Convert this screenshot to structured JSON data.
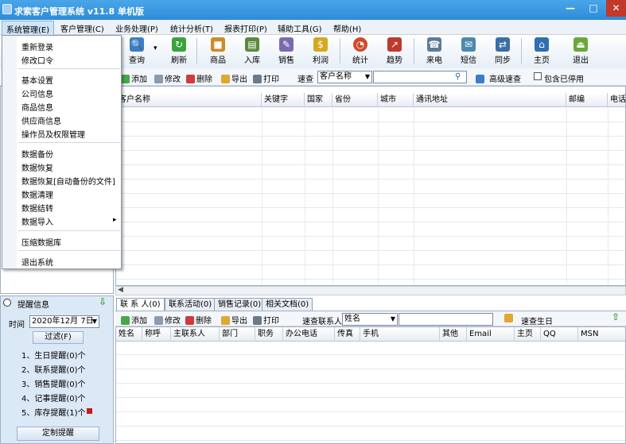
{
  "window": {
    "title": "求索客户管理系统 v11.8 单机版",
    "min": "—",
    "max": "□",
    "close": "✕"
  },
  "menu": [
    "系统管理(E)",
    "客户管理(C)",
    "业务处理(P)",
    "统计分析(T)",
    "报表打印(P)",
    "辅助工具(G)",
    "帮助(H)"
  ],
  "toolbar": [
    {
      "label": "查询",
      "icon": "search-icon",
      "color": "#3a7dc8",
      "glyph": "🔍"
    },
    {
      "label": "刷新",
      "icon": "refresh-icon",
      "color": "#3aa33a",
      "glyph": "↻"
    },
    {
      "label": "商品",
      "icon": "goods-icon",
      "color": "#d08a2a",
      "glyph": "■"
    },
    {
      "label": "入库",
      "icon": "stock-in-icon",
      "color": "#5a8a3a",
      "glyph": "▤"
    },
    {
      "label": "销售",
      "icon": "sales-icon",
      "color": "#7a6ab0",
      "glyph": "✎"
    },
    {
      "label": "利润",
      "icon": "profit-icon",
      "color": "#d6a820",
      "glyph": "$"
    },
    {
      "label": "统计",
      "icon": "pie-chart-icon",
      "color": "#d04a2a",
      "glyph": "◔"
    },
    {
      "label": "趋势",
      "icon": "trend-icon",
      "color": "#c0392b",
      "glyph": "↗"
    },
    {
      "label": "来电",
      "icon": "phone-icon",
      "color": "#607a9a",
      "glyph": "☎"
    },
    {
      "label": "短信",
      "icon": "sms-icon",
      "color": "#4a8ab0",
      "glyph": "✉"
    },
    {
      "label": "同步",
      "icon": "sync-icon",
      "color": "#3a6ea8",
      "glyph": "⇄"
    },
    {
      "label": "主页",
      "icon": "home-icon",
      "color": "#2f6fb0",
      "glyph": "⌂"
    },
    {
      "label": "退出",
      "icon": "exit-icon",
      "color": "#6aa83a",
      "glyph": "⏏"
    }
  ],
  "toolbar_more": "▾",
  "cmdbar": {
    "add": "添加",
    "edit": "修改",
    "delete": "删除",
    "export": "导出",
    "print": "打印",
    "quick_search": "速查",
    "field": "客户名称",
    "advanced": "高级速查",
    "include_disabled": "包含已停用"
  },
  "columns": [
    "客户名称",
    "关键字",
    "国家",
    "省份",
    "城市",
    "通讯地址",
    "邮编",
    "电话"
  ],
  "dropdown": {
    "group1": [
      "重新登录",
      "修改口令"
    ],
    "group2": [
      "基本设置",
      "公司信息",
      "商品信息",
      "供应商信息",
      "操作员及权限管理"
    ],
    "group3": [
      "数据备份",
      "数据恢复",
      "数据恢复[自动备份的文件]",
      "数据清理",
      "数据结转",
      "数据导入"
    ],
    "submenu_arrow": "▸",
    "group4": [
      "压缩数据库"
    ],
    "group5": [
      "退出系统"
    ]
  },
  "remind": {
    "title": "提醒信息",
    "time_label": "时间",
    "date": "2020年12月  7日",
    "filter": "过滤(F)",
    "items": [
      "1、生日提醒(0)个",
      "2、联系提醒(0)个",
      "3、销售提醒(0)个",
      "4、记事提醒(0)个",
      "5、库存提醒(1)个"
    ],
    "custom": "定制提醒"
  },
  "tabs": [
    "联 系 人(0)",
    "联系活动(0)",
    "销售记录(0)",
    "相关文档(0)"
  ],
  "cmdbar2": {
    "add": "添加",
    "edit": "修改",
    "delete": "删除",
    "export": "导出",
    "print": "打印",
    "quick_search": "速查联系人",
    "field": "姓名",
    "birthday": "速查生日"
  },
  "columns2": [
    "姓名",
    "称呼",
    "主联系人",
    "部门",
    "职务",
    "办公电话",
    "传真",
    "手机",
    "其他",
    "Email",
    "主页",
    "QQ",
    "MSN"
  ],
  "colors": {
    "accent": "#2d8bd8",
    "panel": "#dbe8f6",
    "alert": "#d01818"
  }
}
